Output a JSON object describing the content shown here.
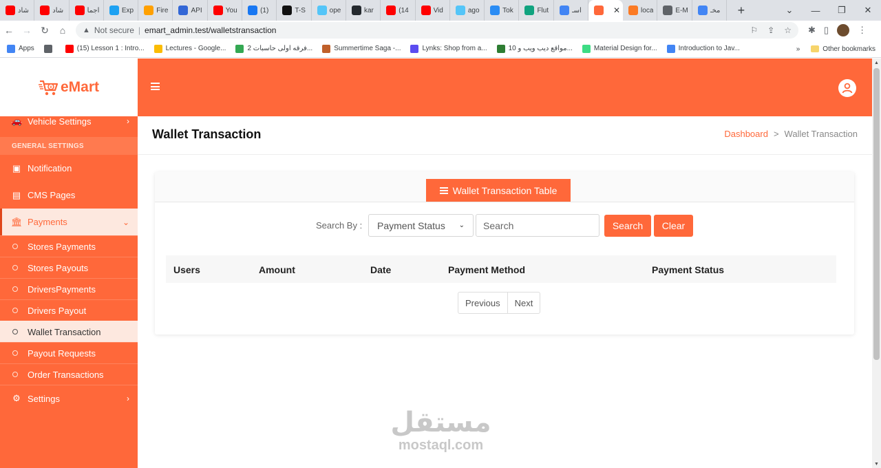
{
  "browser": {
    "tabs": [
      {
        "title": "شاد",
        "icon": "youtube-icon",
        "color": "#ff0000"
      },
      {
        "title": "شاد",
        "icon": "youtube-icon",
        "color": "#ff0000"
      },
      {
        "title": "اجما",
        "icon": "youtube-icon",
        "color": "#ff0000"
      },
      {
        "title": "Exp",
        "icon": "twitter-icon",
        "color": "#1da1f2"
      },
      {
        "title": "Fire",
        "icon": "firebase-icon",
        "color": "#ffa000"
      },
      {
        "title": "API",
        "icon": "api-icon",
        "color": "#3367d6"
      },
      {
        "title": "You",
        "icon": "youtube-icon",
        "color": "#ff0000"
      },
      {
        "title": "(1)",
        "icon": "facebook-icon",
        "color": "#1877f2"
      },
      {
        "title": "T-S",
        "icon": "tsql-icon",
        "color": "#111111"
      },
      {
        "title": "ope",
        "icon": "flutter-icon",
        "color": "#54c5f8"
      },
      {
        "title": "kar",
        "icon": "github-icon",
        "color": "#24292e"
      },
      {
        "title": "(14",
        "icon": "youtube-icon",
        "color": "#ff0000"
      },
      {
        "title": "Vid",
        "icon": "youtube-icon",
        "color": "#ff0000"
      },
      {
        "title": "ago",
        "icon": "flutter-icon",
        "color": "#54c5f8"
      },
      {
        "title": "Tok",
        "icon": "tok-icon",
        "color": "#2a8cf4"
      },
      {
        "title": "Flut",
        "icon": "chatgpt-icon",
        "color": "#10a37f"
      },
      {
        "title": "اسـ",
        "icon": "google-icon",
        "color": "#4285f4"
      }
    ],
    "active_tab": {
      "icon": "emart-icon",
      "color": "#ff683a"
    },
    "tabs_after": [
      {
        "title": "loca",
        "icon": "xampp-icon",
        "color": "#fb7a24"
      },
      {
        "title": "E-M",
        "icon": "globe-icon",
        "color": "#5f6368"
      },
      {
        "title": "مخـ",
        "icon": "google-icon",
        "color": "#4285f4"
      }
    ],
    "address": {
      "security_label": "Not secure",
      "url": "emart_admin.test/walletstransaction"
    },
    "bookmarks": [
      {
        "label": "Apps",
        "color": "#4285f4"
      },
      {
        "label": "",
        "color": "#5f6368"
      },
      {
        "label": "(15) Lesson 1 : Intro...",
        "color": "#ff0000"
      },
      {
        "label": "Lectures - Google...",
        "color": "#fbbc04"
      },
      {
        "label": "فرقه اولى حاسبات 2...",
        "color": "#34a853"
      },
      {
        "label": "Summertime Saga -...",
        "color": "#c0602a"
      },
      {
        "label": "Lynks: Shop from a...",
        "color": "#5b4cf0"
      },
      {
        "label": "10 مواقع ديب ويب و...",
        "color": "#2e7d32"
      },
      {
        "label": "Material Design for...",
        "color": "#3ddc84"
      },
      {
        "label": "Introduction to Jav...",
        "color": "#4285f4"
      }
    ],
    "bookmarks_more": "»",
    "other_bookmarks": "Other bookmarks"
  },
  "sidebar": {
    "logo_text": "eMart",
    "vehicle_settings": "Vehicle Settings",
    "section_label": "GENERAL SETTINGS",
    "notification": "Notification",
    "cms_pages": "CMS Pages",
    "payments": "Payments",
    "sub_items": [
      "Stores Payments",
      "Stores Payouts",
      "DriversPayments",
      "Drivers Payout",
      "Wallet Transaction",
      "Payout Requests",
      "Order Transactions"
    ],
    "active_sub_item": "Wallet Transaction",
    "settings": "Settings"
  },
  "page": {
    "title": "Wallet Transaction",
    "breadcrumb": {
      "home": "Dashboard",
      "separator": ">",
      "current": "Wallet Transaction"
    }
  },
  "card": {
    "tab_label": "Wallet Transaction Table",
    "search_label": "Search By :",
    "select_value": "Payment Status",
    "search_placeholder": "Search",
    "search_button": "Search",
    "clear_button": "Clear",
    "columns": [
      "Users",
      "Amount",
      "Date",
      "Payment Method",
      "Payment Status"
    ],
    "pager": {
      "previous": "Previous",
      "next": "Next"
    }
  },
  "watermark": {
    "arabic": "مستقل",
    "latin": "mostaql.com"
  },
  "colors": {
    "accent": "#ff683a",
    "active_bg": "#fde8df"
  }
}
